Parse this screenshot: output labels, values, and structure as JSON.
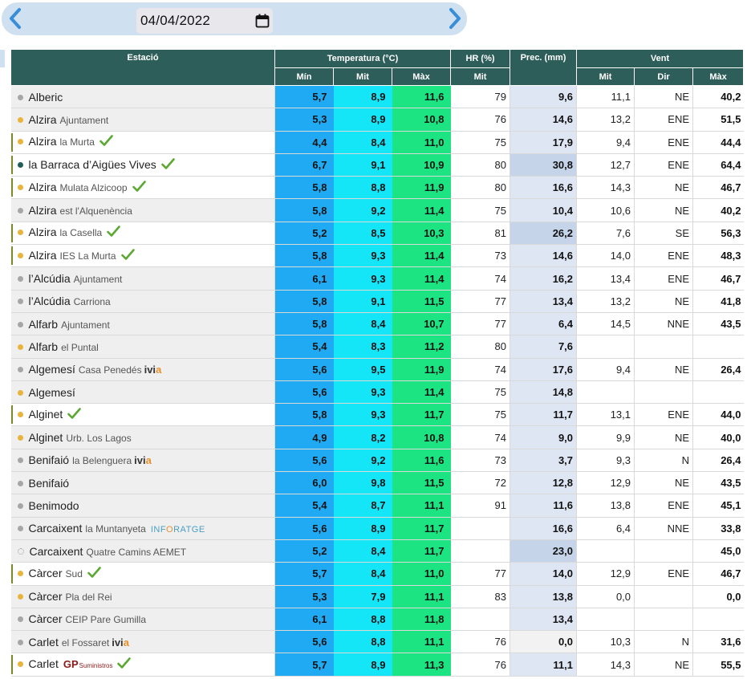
{
  "nav": {
    "date": "04/04/2022"
  },
  "table": {
    "headers": {
      "station": "Estació",
      "temperature": "Temperatura (°C)",
      "hr": "HR (%)",
      "prec": "Prec. (mm)",
      "wind": "Vent",
      "t_min": "Mín",
      "t_mit": "Mit",
      "t_max": "Màx",
      "hr_mit": "Mit",
      "w_mit": "Mit",
      "w_dir": "Dir",
      "w_max": "Màx"
    },
    "colors": {
      "temp_min": "#21aaf4",
      "temp_mit": "#14e6f8",
      "temp_max": "#1ce482",
      "header": "#2e5e5a"
    },
    "rows": [
      {
        "town": "Alberic",
        "sub": "",
        "dot": "g",
        "flag": false,
        "check": false,
        "logo": "",
        "tmin": "5,7",
        "tmit": "8,9",
        "tmax": "11,6",
        "hr": "79",
        "prec": "9,6",
        "pshade": "",
        "wmit": "11,1",
        "wdir": "NE",
        "wmax": "40,2"
      },
      {
        "town": "Alzira",
        "sub": "Ajuntament",
        "dot": "y",
        "flag": false,
        "check": false,
        "logo": "",
        "tmin": "5,3",
        "tmit": "8,9",
        "tmax": "10,8",
        "hr": "76",
        "prec": "14,6",
        "pshade": "",
        "wmit": "13,2",
        "wdir": "ENE",
        "wmax": "51,5"
      },
      {
        "town": "Alzira",
        "sub": "la Murta",
        "dot": "y",
        "flag": true,
        "check": true,
        "logo": "",
        "tmin": "4,4",
        "tmit": "8,4",
        "tmax": "11,0",
        "hr": "75",
        "prec": "17,9",
        "pshade": "",
        "wmit": "9,4",
        "wdir": "ENE",
        "wmax": "44,4"
      },
      {
        "town": "la Barraca d’Aigües Vives",
        "sub": "",
        "dot": "t",
        "flag": true,
        "check": true,
        "logo": "",
        "tmin": "6,7",
        "tmit": "9,1",
        "tmax": "10,9",
        "hr": "80",
        "prec": "30,8",
        "pshade": "hi",
        "wmit": "12,7",
        "wdir": "ENE",
        "wmax": "64,4"
      },
      {
        "town": "Alzira",
        "sub": "Mulata Alzicoop",
        "dot": "y",
        "flag": true,
        "check": true,
        "logo": "",
        "tmin": "5,8",
        "tmit": "8,8",
        "tmax": "11,9",
        "hr": "80",
        "prec": "16,6",
        "pshade": "",
        "wmit": "14,3",
        "wdir": "NE",
        "wmax": "46,7"
      },
      {
        "town": "Alzira",
        "sub": "est l'Alquenència",
        "dot": "g",
        "flag": false,
        "check": false,
        "logo": "",
        "tmin": "5,8",
        "tmit": "9,2",
        "tmax": "11,4",
        "hr": "75",
        "prec": "10,4",
        "pshade": "",
        "wmit": "10,6",
        "wdir": "NE",
        "wmax": "40,2"
      },
      {
        "town": "Alzira",
        "sub": "la Casella",
        "dot": "y",
        "flag": true,
        "check": true,
        "logo": "",
        "tmin": "5,2",
        "tmit": "8,5",
        "tmax": "10,3",
        "hr": "81",
        "prec": "26,2",
        "pshade": "hi",
        "wmit": "7,6",
        "wdir": "SE",
        "wmax": "56,3"
      },
      {
        "town": "Alzira",
        "sub": "IES La Murta",
        "dot": "y",
        "flag": true,
        "check": true,
        "logo": "",
        "tmin": "5,8",
        "tmit": "9,3",
        "tmax": "11,4",
        "hr": "73",
        "prec": "14,6",
        "pshade": "",
        "wmit": "14,0",
        "wdir": "ENE",
        "wmax": "48,3"
      },
      {
        "town": "l’Alcúdia",
        "sub": "Ajuntament",
        "dot": "g",
        "flag": false,
        "check": false,
        "logo": "",
        "tmin": "6,1",
        "tmit": "9,3",
        "tmax": "11,4",
        "hr": "74",
        "prec": "16,2",
        "pshade": "",
        "wmit": "13,4",
        "wdir": "ENE",
        "wmax": "46,7"
      },
      {
        "town": "l’Alcúdia",
        "sub": "Carriona",
        "dot": "g",
        "flag": false,
        "check": false,
        "logo": "",
        "tmin": "5,8",
        "tmit": "9,1",
        "tmax": "11,5",
        "hr": "77",
        "prec": "13,4",
        "pshade": "",
        "wmit": "13,2",
        "wdir": "NE",
        "wmax": "41,8"
      },
      {
        "town": "Alfarb",
        "sub": "Ajuntament",
        "dot": "g",
        "flag": false,
        "check": false,
        "logo": "",
        "tmin": "5,8",
        "tmit": "8,4",
        "tmax": "10,7",
        "hr": "77",
        "prec": "6,4",
        "pshade": "",
        "wmit": "14,5",
        "wdir": "NNE",
        "wmax": "43,5"
      },
      {
        "town": "Alfarb",
        "sub": "el Puntal",
        "dot": "y",
        "flag": false,
        "check": false,
        "logo": "",
        "tmin": "5,4",
        "tmit": "8,3",
        "tmax": "11,2",
        "hr": "80",
        "prec": "7,6",
        "pshade": "",
        "wmit": "",
        "wdir": "",
        "wmax": ""
      },
      {
        "town": "Algemesí",
        "sub": "Casa Penedés",
        "dot": "g",
        "flag": false,
        "check": false,
        "logo": "ivia",
        "tmin": "5,6",
        "tmit": "9,5",
        "tmax": "11,9",
        "hr": "74",
        "prec": "17,6",
        "pshade": "",
        "wmit": "9,4",
        "wdir": "NE",
        "wmax": "26,4"
      },
      {
        "town": "Algemesí",
        "sub": "",
        "dot": "y",
        "flag": false,
        "check": false,
        "logo": "",
        "tmin": "5,6",
        "tmit": "9,3",
        "tmax": "11,4",
        "hr": "75",
        "prec": "14,8",
        "pshade": "",
        "wmit": "",
        "wdir": "",
        "wmax": ""
      },
      {
        "town": "Alginet",
        "sub": "",
        "dot": "y",
        "flag": true,
        "check": true,
        "logo": "",
        "tmin": "5,8",
        "tmit": "9,3",
        "tmax": "11,7",
        "hr": "75",
        "prec": "11,7",
        "pshade": "",
        "wmit": "13,1",
        "wdir": "ENE",
        "wmax": "44,0"
      },
      {
        "town": "Alginet",
        "sub": "Urb. Los Lagos",
        "dot": "y",
        "flag": false,
        "check": false,
        "logo": "",
        "tmin": "4,9",
        "tmit": "8,2",
        "tmax": "10,8",
        "hr": "74",
        "prec": "9,0",
        "pshade": "",
        "wmit": "9,9",
        "wdir": "NE",
        "wmax": "40,0"
      },
      {
        "town": "Benifaió",
        "sub": "la Belenguera",
        "dot": "g",
        "flag": false,
        "check": false,
        "logo": "ivia",
        "tmin": "5,6",
        "tmit": "9,2",
        "tmax": "11,6",
        "hr": "73",
        "prec": "3,7",
        "pshade": "",
        "wmit": "9,3",
        "wdir": "N",
        "wmax": "26,4"
      },
      {
        "town": "Benifaió",
        "sub": "",
        "dot": "g",
        "flag": false,
        "check": false,
        "logo": "",
        "tmin": "6,0",
        "tmit": "9,8",
        "tmax": "11,5",
        "hr": "72",
        "prec": "12,8",
        "pshade": "",
        "wmit": "12,9",
        "wdir": "NE",
        "wmax": "43,5"
      },
      {
        "town": "Benimodo",
        "sub": "",
        "dot": "g",
        "flag": false,
        "check": false,
        "logo": "",
        "tmin": "5,4",
        "tmit": "8,7",
        "tmax": "11,1",
        "hr": "91",
        "prec": "11,6",
        "pshade": "",
        "wmit": "13,8",
        "wdir": "ENE",
        "wmax": "45,1"
      },
      {
        "town": "Carcaixent",
        "sub": "la Muntanyeta",
        "dot": "g",
        "flag": false,
        "check": false,
        "logo": "infor",
        "tmin": "5,6",
        "tmit": "8,9",
        "tmax": "11,7",
        "hr": "",
        "prec": "16,6",
        "pshade": "",
        "wmit": "6,4",
        "wdir": "NNE",
        "wmax": "33,8"
      },
      {
        "town": "Carcaixent",
        "sub": "Quatre Camins AEMET",
        "dot": "o",
        "flag": false,
        "check": false,
        "logo": "",
        "tmin": "5,2",
        "tmit": "8,4",
        "tmax": "11,7",
        "hr": "",
        "prec": "23,0",
        "pshade": "hi",
        "wmit": "",
        "wdir": "",
        "wmax": "45,0"
      },
      {
        "town": "Càrcer",
        "sub": "Sud",
        "dot": "y",
        "flag": true,
        "check": true,
        "logo": "",
        "tmin": "5,7",
        "tmit": "8,4",
        "tmax": "11,0",
        "hr": "77",
        "prec": "14,0",
        "pshade": "",
        "wmit": "12,9",
        "wdir": "ENE",
        "wmax": "46,7"
      },
      {
        "town": "Càrcer",
        "sub": "Pla del Rei",
        "dot": "y",
        "flag": false,
        "check": false,
        "logo": "",
        "tmin": "5,3",
        "tmit": "7,9",
        "tmax": "11,1",
        "hr": "83",
        "prec": "13,8",
        "pshade": "",
        "wmit": "0,0",
        "wdir": "",
        "wmax": "0,0"
      },
      {
        "town": "Càrcer",
        "sub": "CEIP Pare Gumilla",
        "dot": "g",
        "flag": false,
        "check": false,
        "logo": "",
        "tmin": "6,1",
        "tmit": "8,8",
        "tmax": "11,8",
        "hr": "",
        "prec": "13,4",
        "pshade": "",
        "wmit": "",
        "wdir": "",
        "wmax": ""
      },
      {
        "town": "Carlet",
        "sub": "el Fossaret",
        "dot": "g",
        "flag": false,
        "check": false,
        "logo": "ivia",
        "tmin": "5,6",
        "tmit": "8,8",
        "tmax": "11,1",
        "hr": "76",
        "prec": "0,0",
        "pshade": "zero",
        "wmit": "10,3",
        "wdir": "N",
        "wmax": "31,6"
      },
      {
        "town": "Carlet",
        "sub": "",
        "dot": "y",
        "flag": true,
        "check": true,
        "logo": "gp",
        "tmin": "5,7",
        "tmit": "8,9",
        "tmax": "11,3",
        "hr": "76",
        "prec": "11,1",
        "pshade": "",
        "wmit": "14,3",
        "wdir": "NE",
        "wmax": "55,5"
      }
    ],
    "logos": {
      "ivia": {
        "main": "ivi",
        "accent": "a"
      },
      "infor": {
        "main": "INF",
        "accent": "O",
        "rest": "RATGE"
      },
      "gp": {
        "main": "GP",
        "small": "Suministros"
      }
    }
  }
}
